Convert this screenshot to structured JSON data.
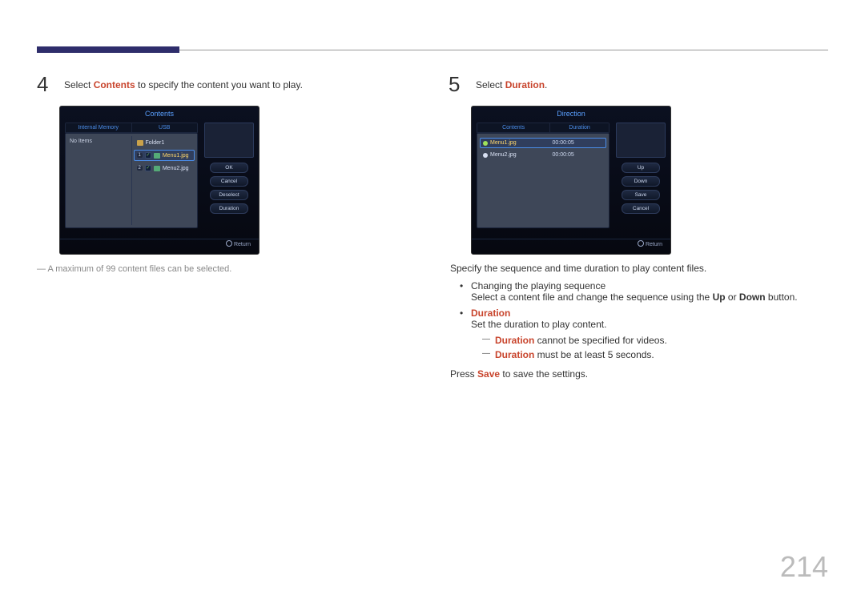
{
  "page_number": "214",
  "step4": {
    "num": "4",
    "pre": "Select ",
    "key": "Contents",
    "post": " to specify the content you want to play."
  },
  "step5": {
    "num": "5",
    "pre": "Select ",
    "key": "Duration",
    "post": "."
  },
  "left_note": "A maximum of 99 content files can be selected.",
  "right_intro": "Specify the sequence and time duration to play content files.",
  "seq_title": "Changing the playing sequence",
  "seq_line_pre": "Select a content file and change the sequence using the ",
  "seq_up": "Up",
  "seq_or": " or ",
  "seq_down": "Down",
  "seq_line_post": " button.",
  "dur_title": "Duration",
  "dur_line": "Set the duration to play content.",
  "dur_sub1_key": "Duration",
  "dur_sub1_post": " cannot be specified for videos.",
  "dur_sub2_key": "Duration",
  "dur_sub2_post": " must be at least 5 seconds.",
  "save_pre": "Press ",
  "save_key": "Save",
  "save_post": " to save the settings.",
  "device_left": {
    "title": "Contents",
    "col1": "Internal Memory",
    "col2": "USB",
    "noitems": "No Items",
    "folder": "Folder1",
    "row1_num": "1",
    "row1_file": "Menu1.jpg",
    "row2_num": "2",
    "row2_file": "Menu2.jpg",
    "btn_ok": "OK",
    "btn_cancel": "Cancel",
    "btn_deselect": "Deselect",
    "btn_duration": "Duration",
    "return": "Return"
  },
  "device_right": {
    "title": "Direction",
    "col1": "Contents",
    "col2": "Duration",
    "row1_file": "Menu1.jpg",
    "row1_time": "00:00:05",
    "row2_file": "Menu2.jpg",
    "row2_time": "00:00:05",
    "btn_up": "Up",
    "btn_down": "Down",
    "btn_save": "Save",
    "btn_cancel": "Cancel",
    "return": "Return"
  }
}
